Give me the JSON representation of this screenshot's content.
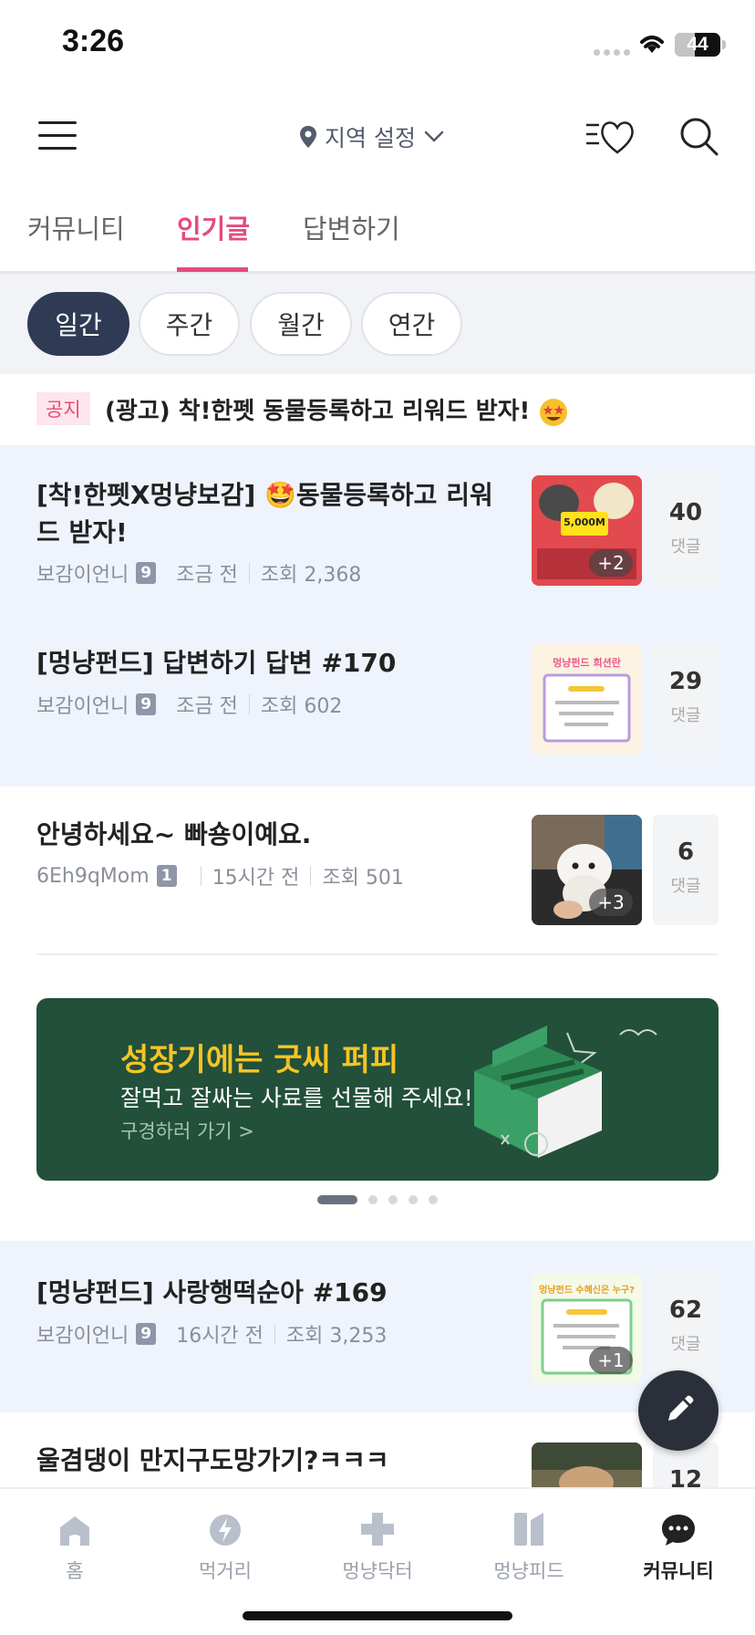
{
  "status": {
    "time": "3:26",
    "battery": "44",
    "battery_fraction": 0.44
  },
  "header": {
    "location_label": "지역 설정",
    "icons": [
      "menu-icon",
      "location-pin-icon",
      "chevron-down-icon",
      "wishlist-heart-icon",
      "search-icon"
    ]
  },
  "tabs": [
    {
      "label": "커뮤니티",
      "active": false
    },
    {
      "label": "인기글",
      "active": true
    },
    {
      "label": "답변하기",
      "active": false
    }
  ],
  "filters": [
    {
      "label": "일간",
      "active": true
    },
    {
      "label": "주간",
      "active": false
    },
    {
      "label": "월간",
      "active": false
    },
    {
      "label": "연간",
      "active": false
    }
  ],
  "notice": {
    "badge": "공지",
    "text": "(광고) 착!한펫 동물등록하고 리워드 받자!"
  },
  "posts": [
    {
      "title": "[착!한펫X멍냥보감] 🤩동물등록하고 리워드 받자!",
      "author": "보감이언니",
      "level": "9",
      "time": "조금 전",
      "views": "조회 2,368",
      "thumb_count": "+2",
      "comments": "40",
      "comment_label": "댓글",
      "thumb_caption": "5,000M"
    },
    {
      "title": "[멍냥펀드] 답변하기 답변 #170",
      "author": "보감이언니",
      "level": "9",
      "time": "조금 전",
      "views": "조회 602",
      "comments": "29",
      "comment_label": "댓글",
      "thumb_caption": "멍냥펀드 희션란"
    },
    {
      "title": "안녕하세요~ 빠숑이예요.",
      "author": "6Eh9qMom",
      "level": "1",
      "time": "15시간 전",
      "views": "조회 501",
      "thumb_count": "+3",
      "comments": "6",
      "comment_label": "댓글"
    },
    {
      "title": "[멍냥펀드] 사랑행떡순아 #169",
      "author": "보감이언니",
      "level": "9",
      "time": "16시간 전",
      "views": "조회 3,253",
      "thumb_count": "+1",
      "comments": "62",
      "comment_label": "댓글",
      "thumb_caption": "멍냥펀드 수혜신은 누구?"
    },
    {
      "title": "울겸댕이 만지구도망가기?ㅋㅋㅋ",
      "comments": "12"
    }
  ],
  "banner": {
    "title": "성장기에는 굿씨 퍼피",
    "subtitle": "잘먹고 잘싸는 사료를 선물해 주세요!",
    "link": "구경하러 가기 >",
    "bg_color": "#22503a",
    "title_color": "#f5c425"
  },
  "carousel": {
    "total": 5,
    "active_index": 0
  },
  "bottom_nav": [
    {
      "label": "홈",
      "icon": "home-icon",
      "active": false
    },
    {
      "label": "먹거리",
      "icon": "food-bolt-icon",
      "active": false
    },
    {
      "label": "멍냥닥터",
      "icon": "medical-cross-icon",
      "active": false
    },
    {
      "label": "멍냥피드",
      "icon": "feed-icon",
      "active": false
    },
    {
      "label": "커뮤니티",
      "icon": "community-chat-icon",
      "active": true
    }
  ],
  "colors": {
    "accent": "#e54b7c",
    "chip_active": "#2f3a54",
    "highlight_row": "#eff3fb"
  }
}
